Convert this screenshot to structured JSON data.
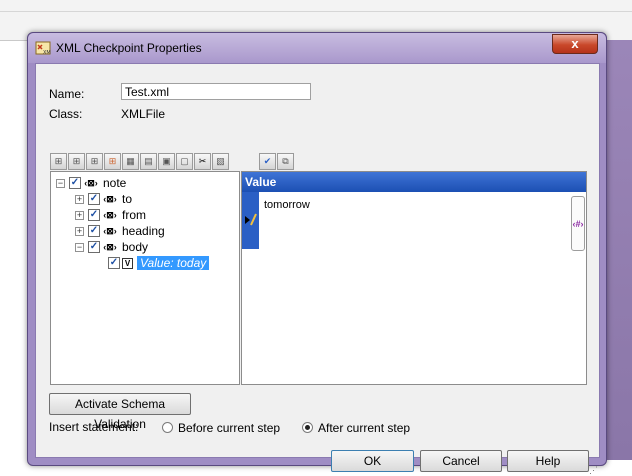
{
  "window": {
    "title": "XML Checkpoint Properties",
    "close_label": "x"
  },
  "form": {
    "name_label": "Name:",
    "name_value": "Test.xml",
    "class_label": "Class:",
    "class_value": "XMLFile"
  },
  "toolbar": {
    "buttons": [
      "add-element",
      "add-sibling",
      "add-child",
      "add-attribute",
      "add-value",
      "insert-xml",
      "copy",
      "paste",
      "cut",
      "delete"
    ],
    "right_buttons": [
      "select-all",
      "deselect-all"
    ]
  },
  "tree": {
    "nodes": [
      {
        "label": "note",
        "expand": "−"
      },
      {
        "label": "to",
        "expand": "+"
      },
      {
        "label": "from",
        "expand": "+"
      },
      {
        "label": "heading",
        "expand": "+"
      },
      {
        "label": "body",
        "expand": "−"
      },
      {
        "label": "Value: today",
        "selected": true
      }
    ]
  },
  "value_panel": {
    "header": "Value",
    "text": "tomorrow",
    "edit_glyph": "‹#›"
  },
  "buttons": {
    "activate_schema": "Activate Schema Validation",
    "ok": "OK",
    "cancel": "Cancel",
    "help": "Help"
  },
  "insert_statement": {
    "label": "Insert statement:",
    "before": "Before current step",
    "after": "After current step",
    "selected": "after"
  },
  "colors": {
    "title_bar": "#a998cc",
    "value_header": "#2556bf",
    "selection": "#3399ff"
  }
}
